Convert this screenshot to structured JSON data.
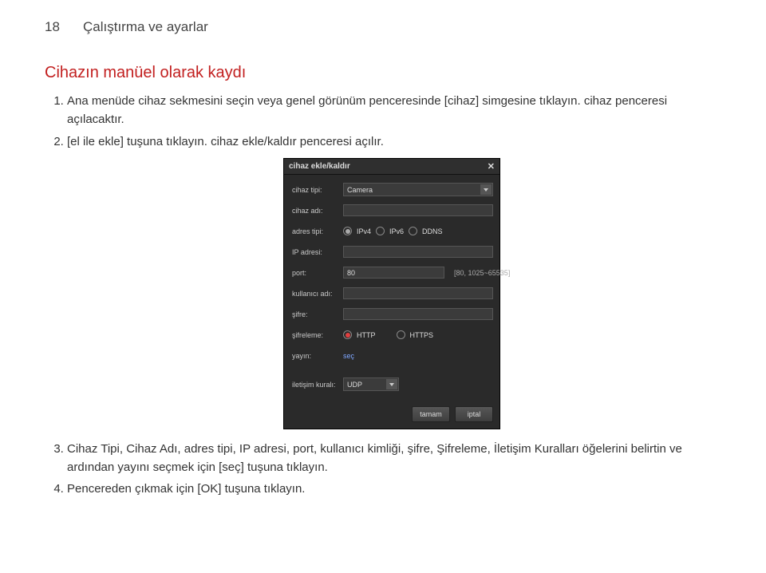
{
  "page": {
    "number": "18",
    "header": "Çalıştırma ve ayarlar"
  },
  "section": {
    "title": "Cihazın manüel olarak kaydı"
  },
  "steps": {
    "s1": "Ana menüde cihaz sekmesini seçin veya genel görünüm penceresinde [cihaz] simgesine tıklayın. cihaz penceresi açılacaktır.",
    "s2": "[el ile ekle] tuşuna tıklayın. cihaz ekle/kaldır penceresi açılır.",
    "s3": "Cihaz Tipi, Cihaz Adı, adres tipi, IP adresi, port, kullanıcı kimliği, şifre, Şifreleme, İletişim Kuralları öğelerini belirtin ve ardından yayını seçmek için [seç] tuşuna tıklayın.",
    "s4": "Pencereden çıkmak için [OK] tuşuna tıklayın."
  },
  "dialog": {
    "title": "cihaz ekle/kaldır",
    "labels": {
      "device_type": "cihaz tipi:",
      "device_name": "cihaz adı:",
      "address_type": "adres tipi:",
      "ip": "IP adresi:",
      "port": "port:",
      "user": "kullanıcı adı:",
      "pass": "şifre:",
      "encryption": "şifreleme:",
      "stream": "yayın:",
      "protocol": "iletişim kuralı:"
    },
    "values": {
      "device_type": "Camera",
      "device_name": "",
      "ip": "",
      "port": "80",
      "user": "",
      "pass": "",
      "protocol": "UDP"
    },
    "address_options": {
      "ipv4": "IPv4",
      "ipv6": "IPv6",
      "ddns": "DDNS"
    },
    "encryption_options": {
      "http": "HTTP",
      "https": "HTTPS"
    },
    "port_hint": "[80, 1025~65535]",
    "stream_link": "seç",
    "buttons": {
      "ok": "tamam",
      "cancel": "iptal"
    }
  }
}
